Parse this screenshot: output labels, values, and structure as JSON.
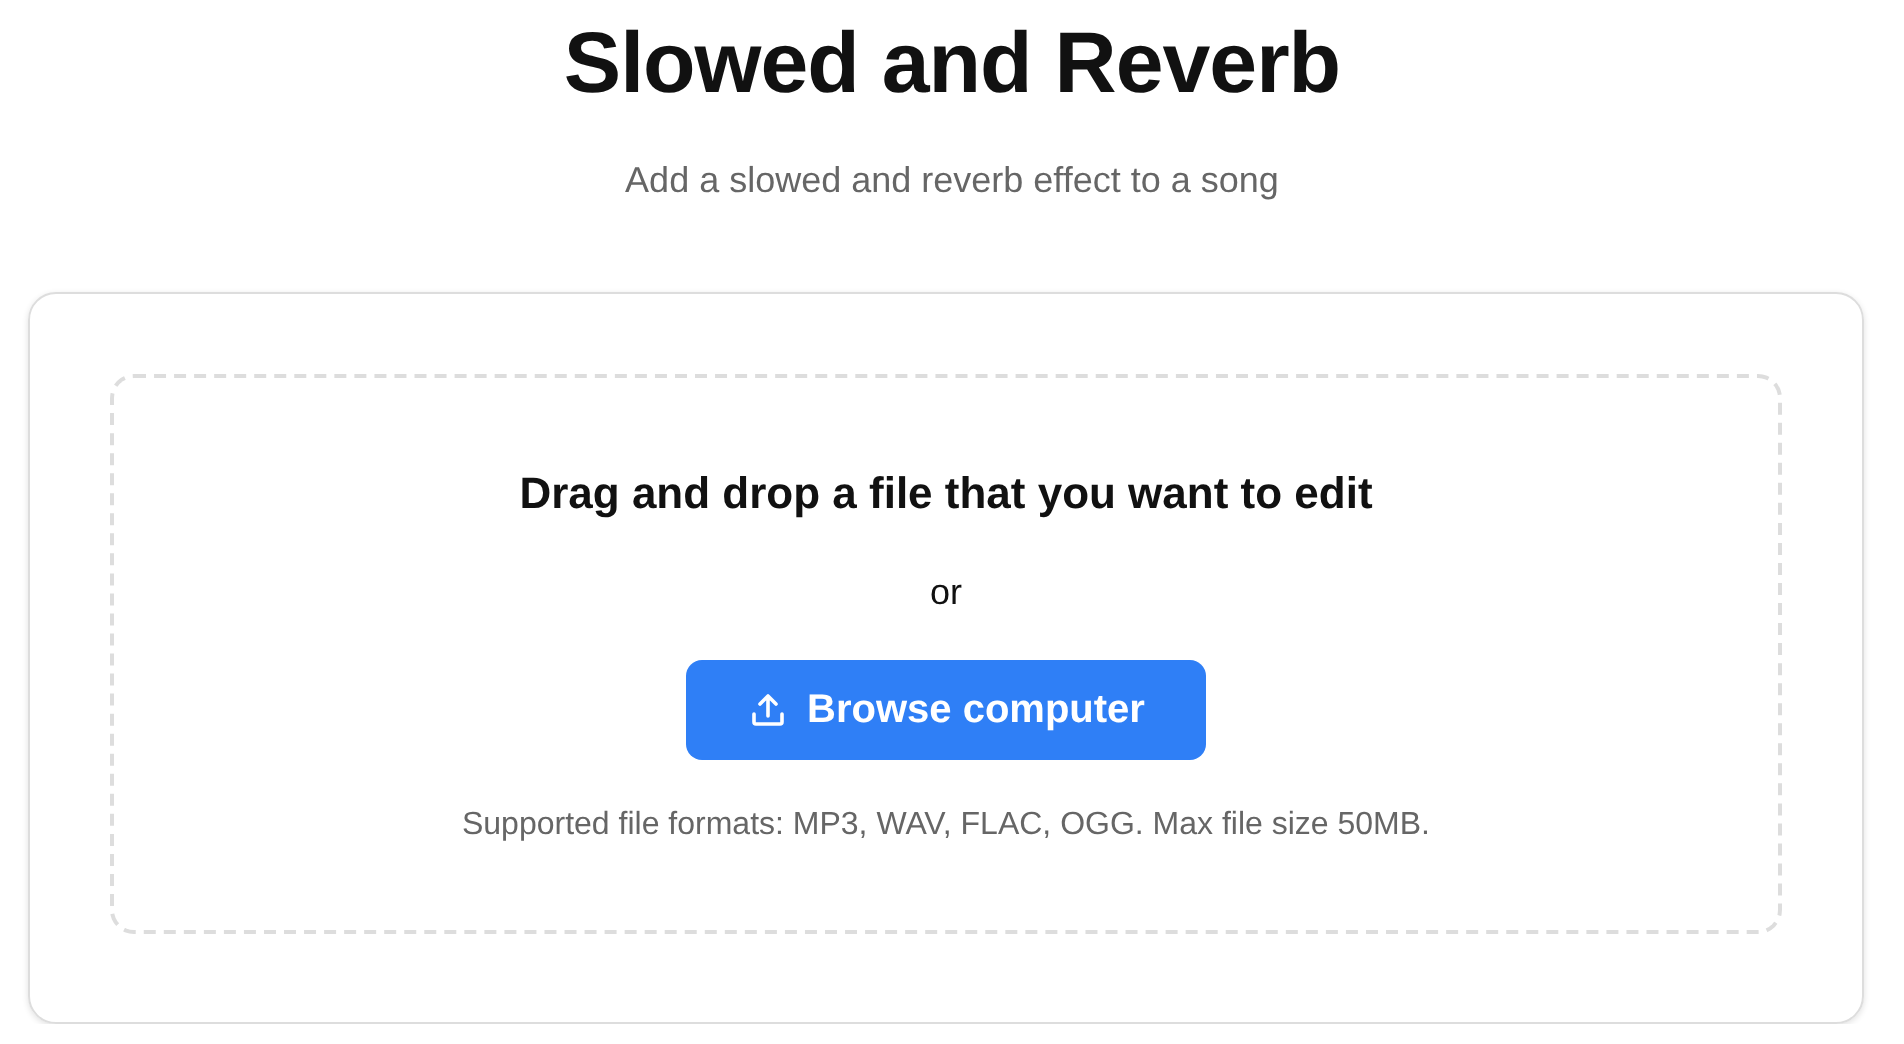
{
  "header": {
    "title": "Slowed and Reverb",
    "subtitle": "Add a slowed and reverb effect to a song"
  },
  "upload": {
    "heading": "Drag and drop a file that you want to edit",
    "separator": "or",
    "button": "Browse computer",
    "note": "Supported file formats: MP3, WAV, FLAC, OGG. Max file size 50MB."
  }
}
